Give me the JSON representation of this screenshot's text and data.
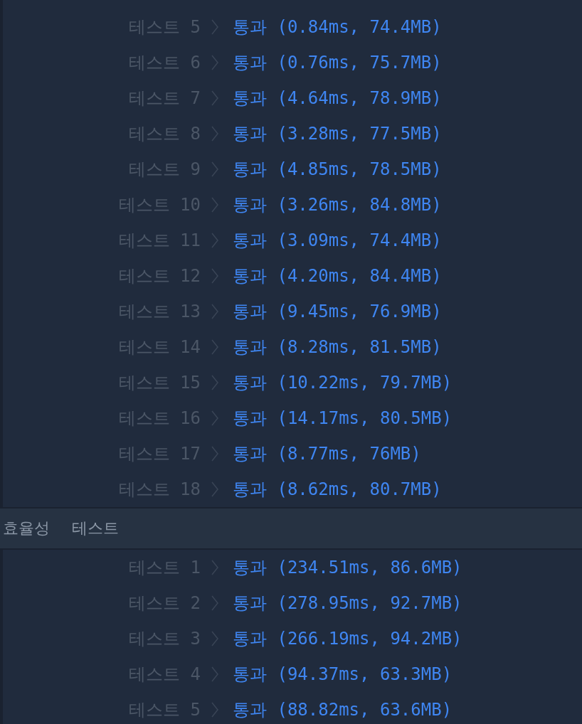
{
  "sections": [
    {
      "tests": [
        {
          "label": "테스트 5",
          "result": "통과 (0.84ms, 74.4MB)"
        },
        {
          "label": "테스트 6",
          "result": "통과 (0.76ms, 75.7MB)"
        },
        {
          "label": "테스트 7",
          "result": "통과 (4.64ms, 78.9MB)"
        },
        {
          "label": "테스트 8",
          "result": "통과 (3.28ms, 77.5MB)"
        },
        {
          "label": "테스트 9",
          "result": "통과 (4.85ms, 78.5MB)"
        },
        {
          "label": "테스트 10",
          "result": "통과 (3.26ms, 84.8MB)"
        },
        {
          "label": "테스트 11",
          "result": "통과 (3.09ms, 74.4MB)"
        },
        {
          "label": "테스트 12",
          "result": "통과 (4.20ms, 84.4MB)"
        },
        {
          "label": "테스트 13",
          "result": "통과 (9.45ms, 76.9MB)"
        },
        {
          "label": "테스트 14",
          "result": "통과 (8.28ms, 81.5MB)"
        },
        {
          "label": "테스트 15",
          "result": "통과 (10.22ms, 79.7MB)"
        },
        {
          "label": "테스트 16",
          "result": "통과 (14.17ms, 80.5MB)"
        },
        {
          "label": "테스트 17",
          "result": "통과 (8.77ms, 76MB)"
        },
        {
          "label": "테스트 18",
          "result": "통과 (8.62ms, 80.7MB)"
        }
      ]
    },
    {
      "title": "효율성 테스트",
      "tests": [
        {
          "label": "테스트 1",
          "result": "통과 (234.51ms, 86.6MB)"
        },
        {
          "label": "테스트 2",
          "result": "통과 (278.95ms, 92.7MB)"
        },
        {
          "label": "테스트 3",
          "result": "통과 (266.19ms, 94.2MB)"
        },
        {
          "label": "테스트 4",
          "result": "통과 (94.37ms, 63.3MB)"
        },
        {
          "label": "테스트 5",
          "result": "통과 (88.82ms, 63.6MB)"
        }
      ]
    }
  ]
}
